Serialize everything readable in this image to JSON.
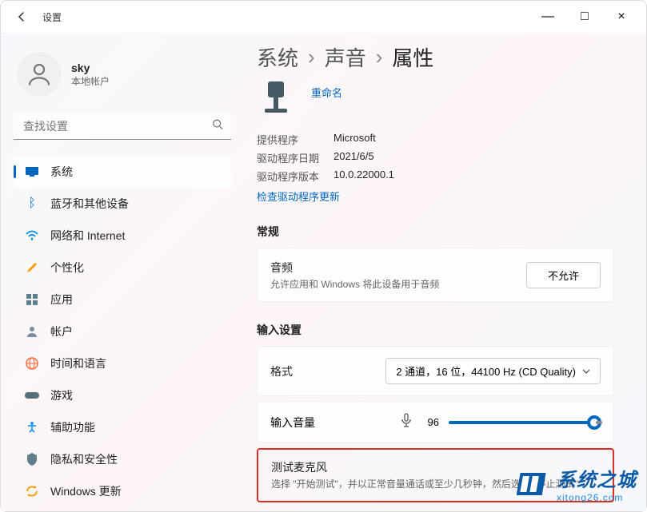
{
  "window": {
    "title": "设置",
    "minimize": "—",
    "maximize": "□",
    "close": "×"
  },
  "user": {
    "name": "sky",
    "account_type": "本地帐户"
  },
  "search": {
    "placeholder": "查找设置"
  },
  "nav": {
    "items": [
      {
        "label": "系统",
        "active": true
      },
      {
        "label": "蓝牙和其他设备"
      },
      {
        "label": "网络和 Internet"
      },
      {
        "label": "个性化"
      },
      {
        "label": "应用"
      },
      {
        "label": "帐户"
      },
      {
        "label": "时间和语言"
      },
      {
        "label": "游戏"
      },
      {
        "label": "辅助功能"
      },
      {
        "label": "隐私和安全性"
      },
      {
        "label": "Windows 更新"
      }
    ]
  },
  "breadcrumb": {
    "a": "系统",
    "b": "声音",
    "c": "属性",
    "sep": "›"
  },
  "device": {
    "rename": "重命名",
    "info": {
      "provider_k": "提供程序",
      "provider_v": "Microsoft",
      "date_k": "驱动程序日期",
      "date_v": "2021/6/5",
      "version_k": "驱动程序版本",
      "version_v": "10.0.22000.1"
    },
    "check_update": "检查驱动程序更新"
  },
  "sections": {
    "general": "常规",
    "audio": {
      "title": "音频",
      "sub": "允许应用和 Windows 将此设备用于音频",
      "button": "不允许"
    },
    "input_settings": "输入设置",
    "format": {
      "title": "格式",
      "value": "2 通道，16 位，44100 Hz (CD Quality)"
    },
    "volume": {
      "title": "输入音量",
      "value": "96"
    },
    "test": {
      "title": "测试麦克风",
      "sub": "选择 \"开始测试\"，并以正常音量通话或至少几秒钟，然后选择 \"停止测试\""
    }
  },
  "watermark": {
    "cn": "系统之城",
    "url": "xitong26.com"
  }
}
